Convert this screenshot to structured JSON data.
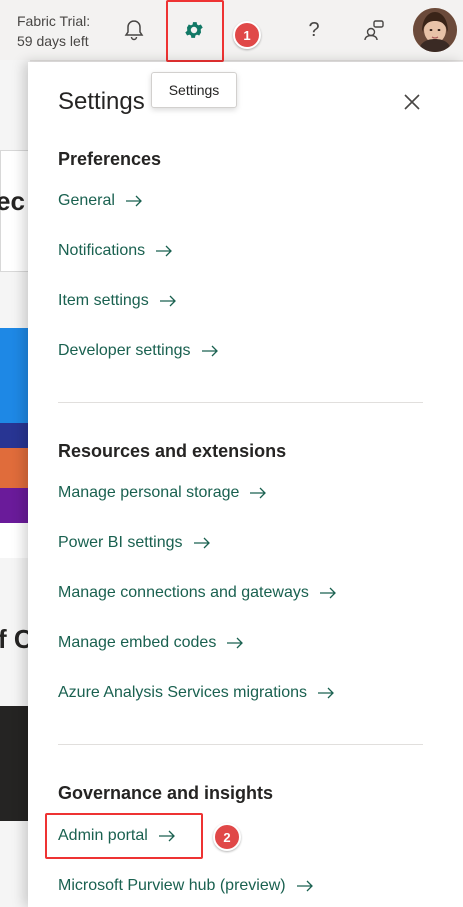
{
  "topbar": {
    "trial_line1": "Fabric Trial:",
    "trial_line2": "59 days left",
    "icons": [
      "bell-icon",
      "gear-icon",
      "help-icon",
      "share-icon"
    ],
    "help_glyph": "?"
  },
  "tooltip": {
    "text": "Settings"
  },
  "annotations": {
    "badge1": "1",
    "badge2": "2",
    "highlight_color": "#e33333"
  },
  "background": {
    "frag1": "ec",
    "frag2": "f C"
  },
  "panel": {
    "title": "Settings",
    "sections": [
      {
        "title": "Preferences",
        "links": [
          "General",
          "Notifications",
          "Item settings",
          "Developer settings"
        ]
      },
      {
        "title": "Resources and extensions",
        "links": [
          "Manage personal storage",
          "Power BI settings",
          "Manage connections and gateways",
          "Manage embed codes",
          "Azure Analysis Services migrations"
        ]
      },
      {
        "title": "Governance and insights",
        "links": [
          "Admin portal",
          "Microsoft Purview hub (preview)"
        ]
      }
    ]
  },
  "colors": {
    "link": "#1a6150",
    "accent": "#117865"
  }
}
